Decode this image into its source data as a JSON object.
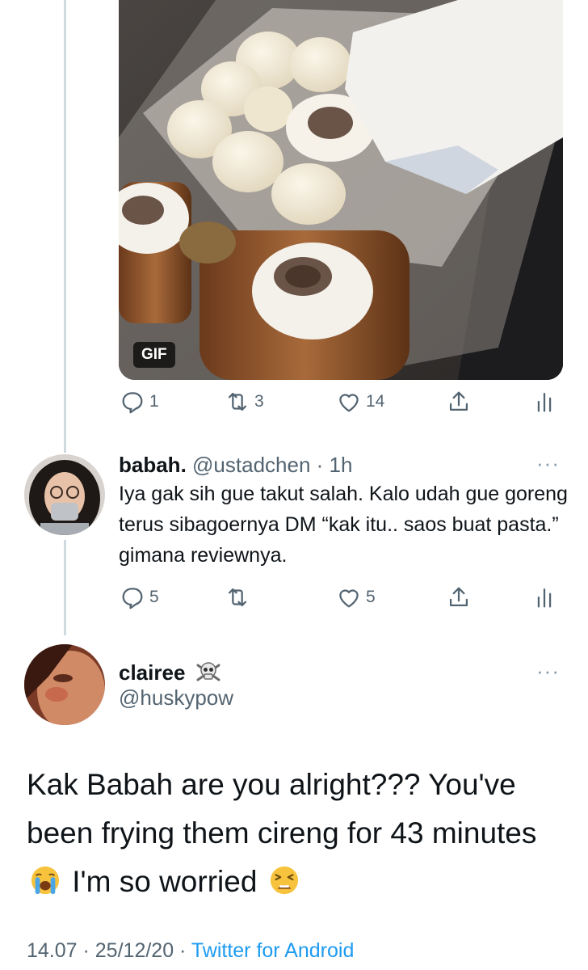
{
  "media": {
    "badge": "GIF",
    "alt": "Food container with cireng and jars of Sibagerio sauce"
  },
  "tweet1": {
    "reply_count": "1",
    "retweet_count": "3",
    "like_count": "14"
  },
  "reply": {
    "display_name": "babah.",
    "handle_time": "@ustadchen · 1h",
    "text": "Iya gak sih gue takut salah. Kalo udah gue goreng terus sibagoernya DM “kak itu.. saos buat pasta.” gimana reviewnya.",
    "reply_count": "5",
    "retweet_count": "",
    "like_count": "5"
  },
  "main_tweet": {
    "display_name": "clairee",
    "handle": "@huskypow",
    "text_line1": "Kak Babah are you alright??? You've been frying them cireng for 43 minutes",
    "text_line2": "I'm so worried",
    "time": "14.07",
    "date": "25/12/20",
    "separator": " · ",
    "source": "Twitter for Android"
  },
  "more_label": "···",
  "colors": {
    "secondary": "#536471",
    "link": "#1d9bf0",
    "thread_line": "#cfd9de"
  }
}
